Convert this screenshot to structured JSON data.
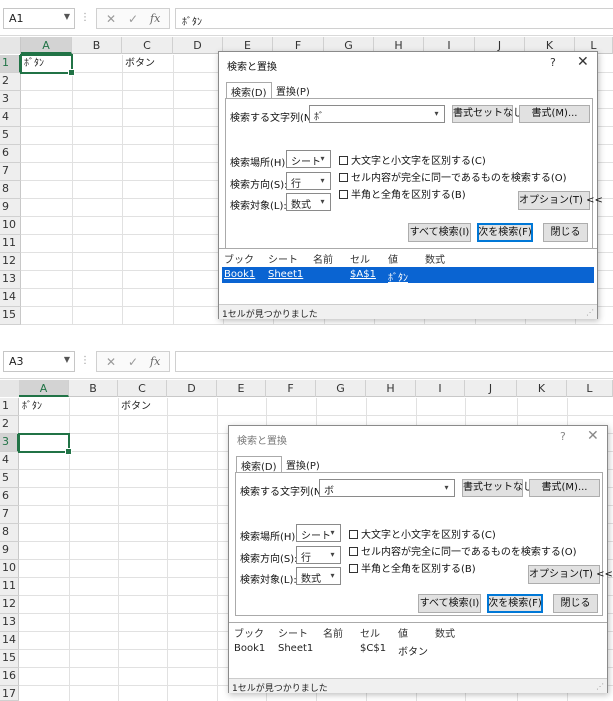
{
  "colors": {
    "excel_green": "#217346",
    "selection_blue": "#0a64d2",
    "default_button_border": "#0078d7"
  },
  "shot1": {
    "name_box": "A1",
    "formula": "ﾎﾞﾀﾝ",
    "columns": [
      "A",
      "B",
      "C",
      "D",
      "E",
      "F",
      "G",
      "H",
      "I",
      "J",
      "K",
      "L"
    ],
    "rows": [
      "1",
      "2",
      "3",
      "4",
      "5",
      "6",
      "7",
      "8",
      "9",
      "10",
      "11",
      "12",
      "13",
      "14",
      "15"
    ],
    "cells": {
      "A1": "ﾎﾞﾀﾝ",
      "C1": "ボタン"
    },
    "dialog": {
      "title": "検索と置換",
      "help": "?",
      "close": "✕",
      "tab_find": "検索(D)",
      "tab_replace": "置換(P)",
      "find_label": "検索する文字列(N):",
      "find_value": "ﾎﾞ",
      "clear_format": "書式セットなし",
      "format": "書式(M)...",
      "within_label": "検索場所(H):",
      "within_value": "シート",
      "search_label": "検索方向(S):",
      "search_value": "行",
      "lookin_label": "検索対象(L):",
      "lookin_value": "数式",
      "match_case": "大文字と小文字を区別する(C)",
      "match_entire": "セル内容が完全に同一であるものを検索する(O)",
      "match_byte": "半角と全角を区別する(B)",
      "options": "オプション(T) <<",
      "find_all": "すべて検索(I)",
      "find_next": "次を検索(F)",
      "close_btn": "閉じる",
      "headers": {
        "book": "ブック",
        "sheet": "シート",
        "name": "名前",
        "cell": "セル",
        "value": "値",
        "formula": "数式"
      },
      "result": {
        "book": "Book1",
        "sheet": "Sheet1",
        "name": "",
        "cell": "$A$1",
        "value": "ﾎﾞﾀﾝ",
        "formula": ""
      },
      "status": "1セルが見つかりました"
    }
  },
  "shot2": {
    "name_box": "A3",
    "formula": "",
    "columns": [
      "A",
      "B",
      "C",
      "D",
      "E",
      "F",
      "G",
      "H",
      "I",
      "J",
      "K",
      "L"
    ],
    "rows": [
      "1",
      "2",
      "3",
      "4",
      "5",
      "6",
      "7",
      "8",
      "9",
      "10",
      "11",
      "12",
      "13",
      "14",
      "15",
      "16",
      "17"
    ],
    "cells": {
      "A1": "ﾎﾞﾀﾝ",
      "C1": "ボタン"
    },
    "dialog": {
      "title": "検索と置換",
      "help": "?",
      "close": "✕",
      "tab_find": "検索(D)",
      "tab_replace": "置換(P)",
      "find_label": "検索する文字列(N):",
      "find_value": "ボ",
      "clear_format": "書式セットなし",
      "format": "書式(M)...",
      "within_label": "検索場所(H):",
      "within_value": "シート",
      "search_label": "検索方向(S):",
      "search_value": "行",
      "lookin_label": "検索対象(L):",
      "lookin_value": "数式",
      "match_case": "大文字と小文字を区別する(C)",
      "match_entire": "セル内容が完全に同一であるものを検索する(O)",
      "match_byte": "半角と全角を区別する(B)",
      "options": "オプション(T) <<",
      "find_all": "すべて検索(I)",
      "find_next": "次を検索(F)",
      "close_btn": "閉じる",
      "headers": {
        "book": "ブック",
        "sheet": "シート",
        "name": "名前",
        "cell": "セル",
        "value": "値",
        "formula": "数式"
      },
      "result": {
        "book": "Book1",
        "sheet": "Sheet1",
        "name": "",
        "cell": "$C$1",
        "value": "ボタン",
        "formula": ""
      },
      "status": "1セルが見つかりました"
    }
  }
}
